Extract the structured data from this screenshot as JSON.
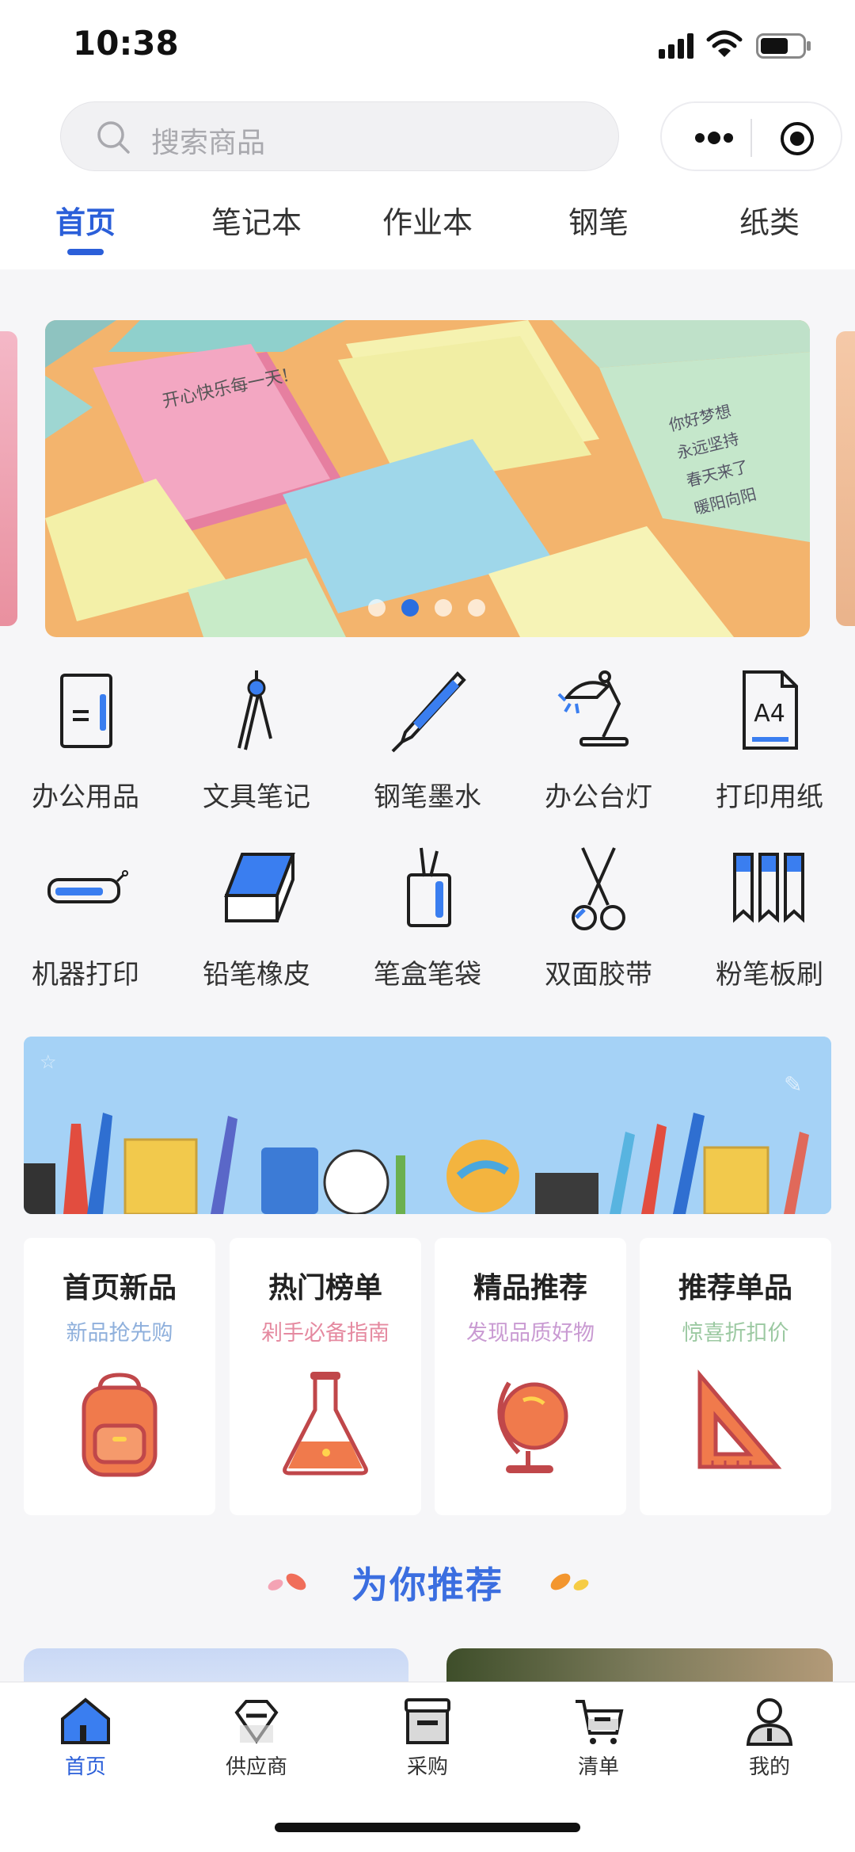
{
  "status": {
    "time": "10:38"
  },
  "search": {
    "placeholder": "搜索商品"
  },
  "tabs": [
    "首页",
    "笔记本",
    "作业本",
    "钢笔",
    "纸类"
  ],
  "banner": {
    "handwriting_left": "开心快乐每一天!",
    "handwriting_right": [
      "你好梦想",
      "永远坚持",
      "春天来了",
      "暖阳向阳"
    ],
    "pages": 4,
    "active_page": 2
  },
  "categories": [
    {
      "label": "办公用品",
      "icon": "notebook-icon"
    },
    {
      "label": "文具笔记",
      "icon": "compass-icon"
    },
    {
      "label": "钢笔墨水",
      "icon": "pen-icon"
    },
    {
      "label": "办公台灯",
      "icon": "desk-lamp-icon"
    },
    {
      "label": "打印用纸",
      "icon": "a4-paper-icon"
    },
    {
      "label": "机器打印",
      "icon": "printer-icon"
    },
    {
      "label": "铅笔橡皮",
      "icon": "eraser-icon"
    },
    {
      "label": "笔盒笔袋",
      "icon": "pen-holder-icon"
    },
    {
      "label": "双面胶带",
      "icon": "scissors-icon"
    },
    {
      "label": "粉笔板刷",
      "icon": "chalk-icon"
    }
  ],
  "features": [
    {
      "title": "首页新品",
      "subtitle": "新品抢先购",
      "color": "#8fb0dc",
      "icon": "backpack-icon"
    },
    {
      "title": "热门榜单",
      "subtitle": "剁手必备指南",
      "color": "#e58aa0",
      "icon": "flask-icon"
    },
    {
      "title": "精品推荐",
      "subtitle": "发现品质好物",
      "color": "#c99ad2",
      "icon": "globe-icon"
    },
    {
      "title": "推荐单品",
      "subtitle": "惊喜折扣价",
      "color": "#9cc9a2",
      "icon": "set-square-icon"
    }
  ],
  "section": {
    "title": "为你推荐"
  },
  "nav": [
    {
      "label": "首页",
      "icon": "home-icon",
      "active": true
    },
    {
      "label": "供应商",
      "icon": "diamond-icon",
      "active": false
    },
    {
      "label": "采购",
      "icon": "store-icon",
      "active": false
    },
    {
      "label": "清单",
      "icon": "cart-icon",
      "active": false
    },
    {
      "label": "我的",
      "icon": "user-icon",
      "active": false
    }
  ],
  "colors": {
    "accent": "#2b5fd9",
    "icon_accent": "#3a7ef0",
    "feature_icon": "#f07a4c"
  }
}
